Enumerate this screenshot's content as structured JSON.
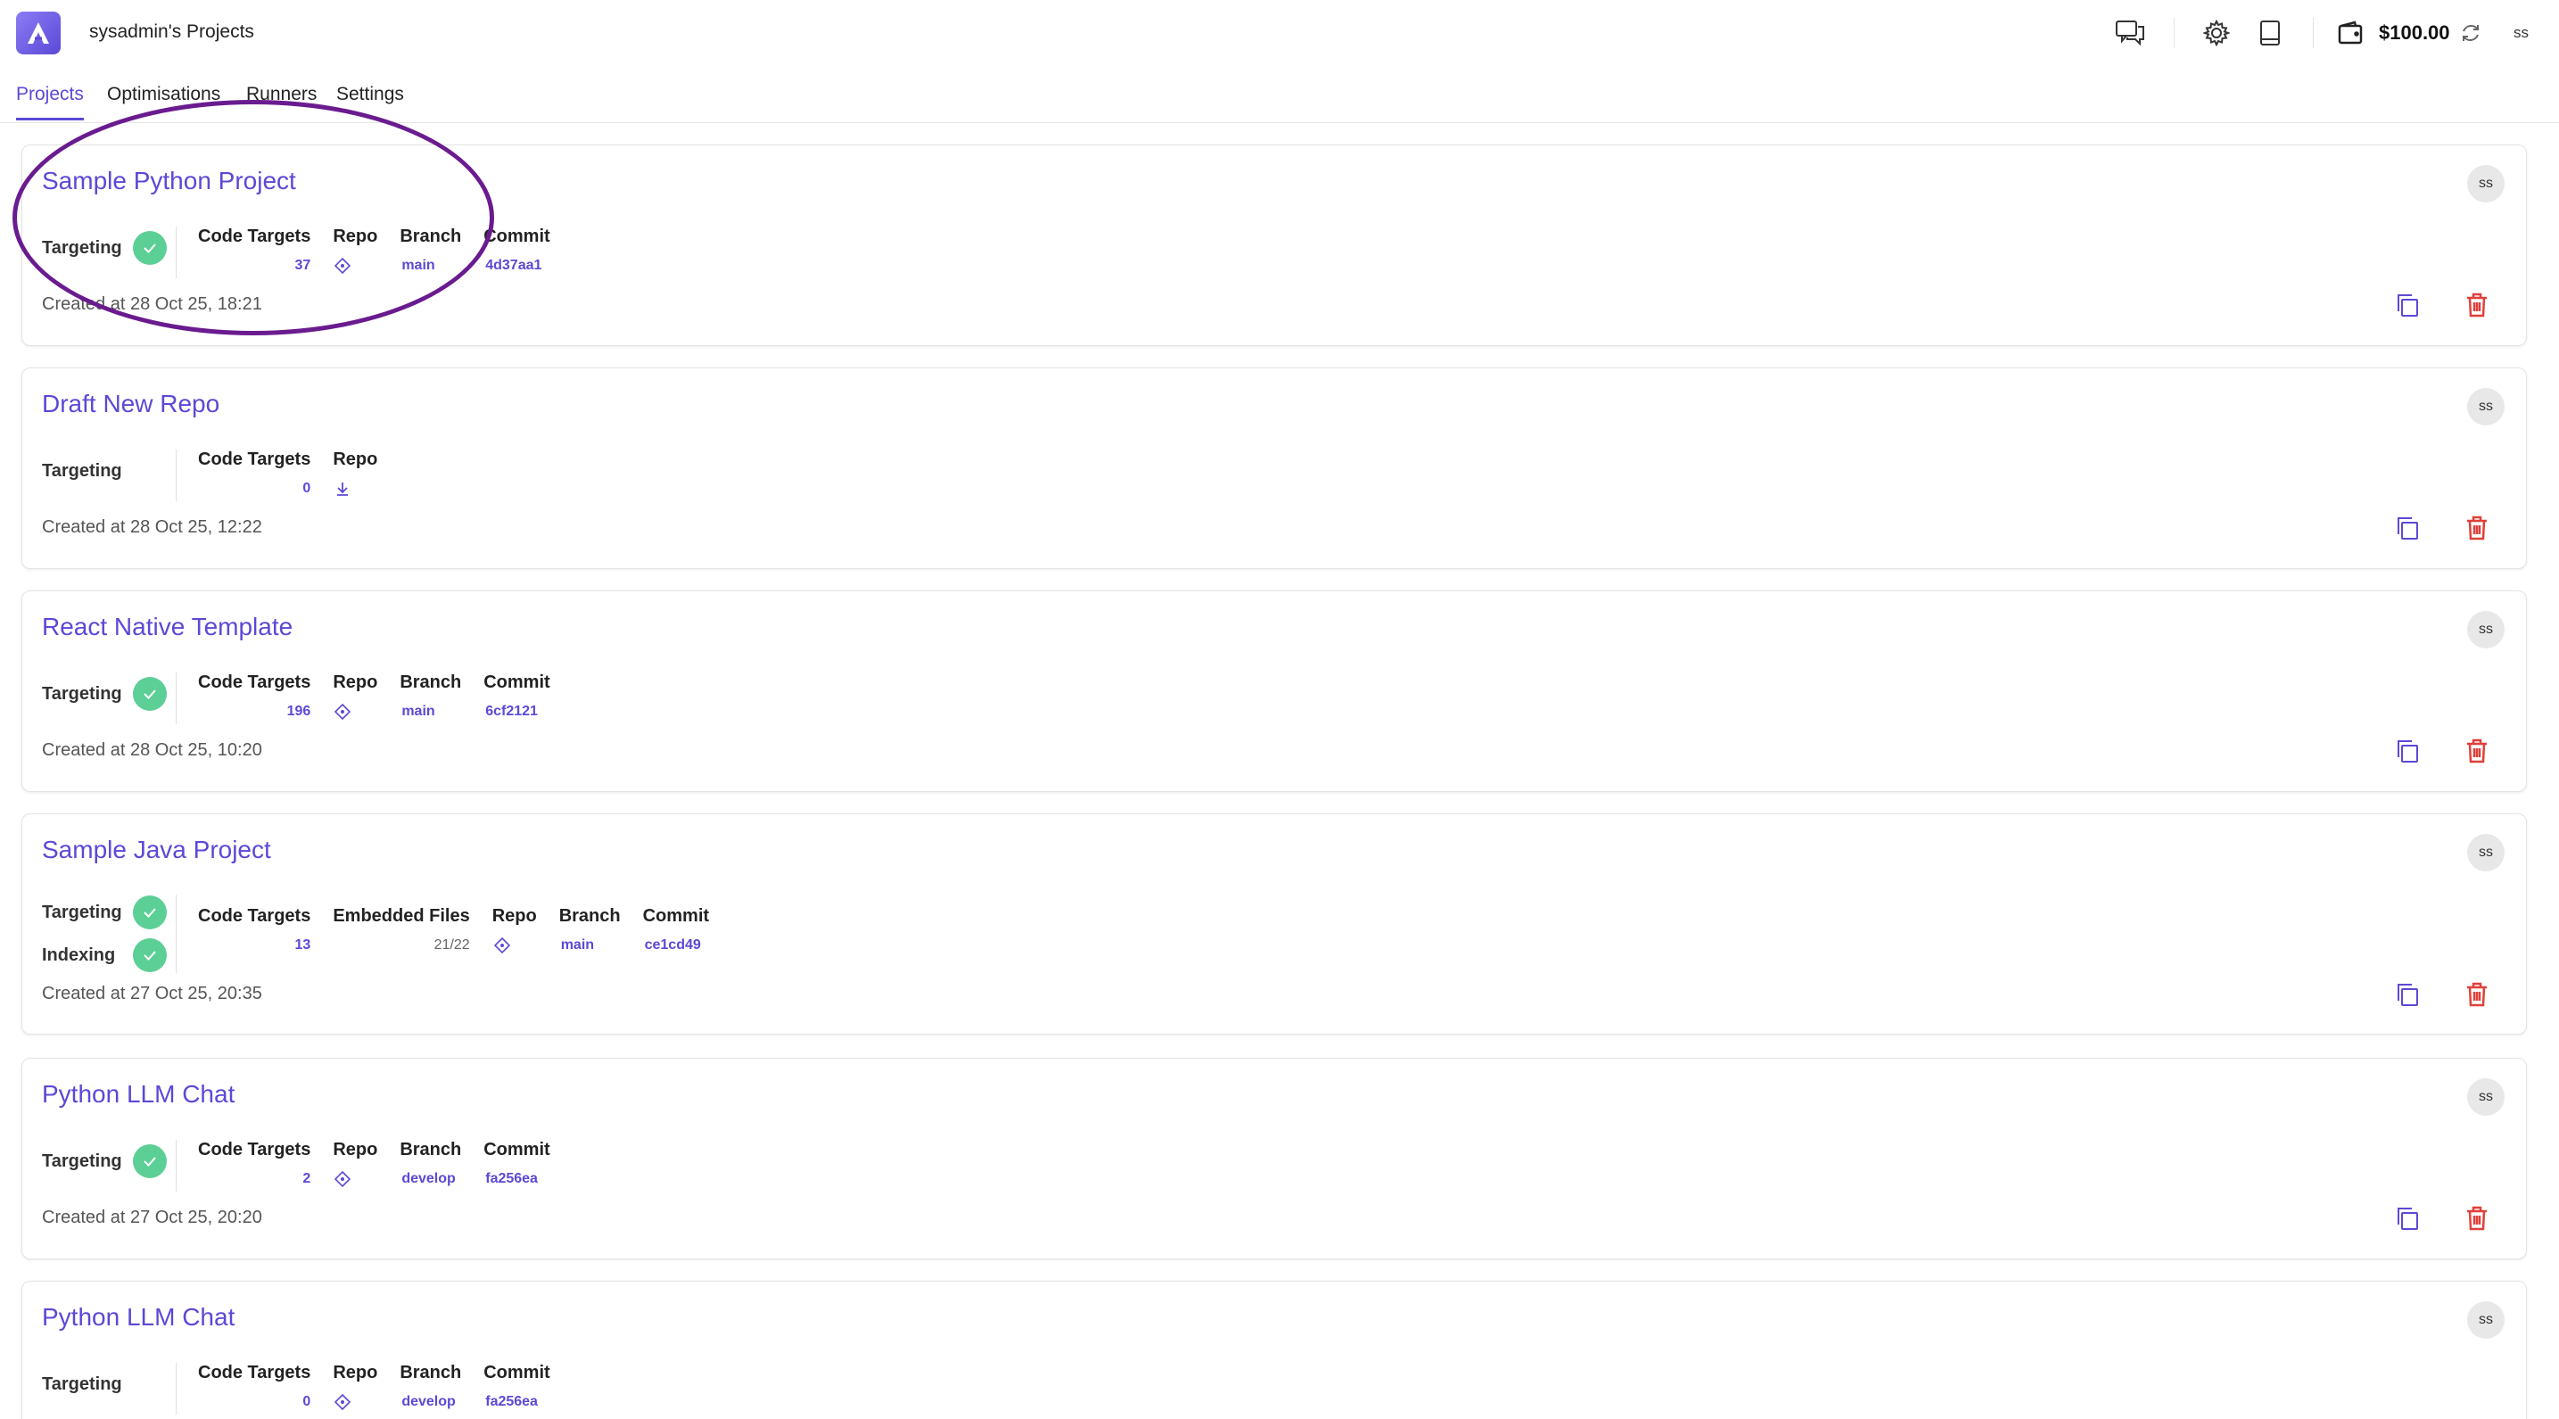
{
  "app": {
    "title": "sysadmin's Projects"
  },
  "header": {
    "balance": "$100.00",
    "user_initials": "ss"
  },
  "tabs": [
    {
      "label": "Projects",
      "active": true
    },
    {
      "label": "Optimisations",
      "active": false
    },
    {
      "label": "Runners",
      "active": false
    },
    {
      "label": "Settings",
      "active": false
    }
  ],
  "colors": {
    "accent": "#5b49d6",
    "success": "#5ccf96",
    "danger": "#e0403a",
    "annotation": "#6a1b8f"
  },
  "labels": {
    "targeting": "Targeting",
    "indexing": "Indexing",
    "code_targets": "Code Targets",
    "embedded_files": "Embedded Files",
    "repo": "Repo",
    "branch": "Branch",
    "commit": "Commit"
  },
  "projects": [
    {
      "name": "Sample Python Project",
      "owner": "ss",
      "targeting_done": true,
      "code_targets": "37",
      "branch": "main",
      "commit": "4d37aa1",
      "created": "Created at 28 Oct 25, 18:21"
    },
    {
      "name": "Draft New Repo",
      "owner": "ss",
      "targeting_done": false,
      "code_targets": "0",
      "created": "Created at 28 Oct 25, 12:22"
    },
    {
      "name": "React Native Template",
      "owner": "ss",
      "targeting_done": true,
      "code_targets": "196",
      "branch": "main",
      "commit": "6cf2121",
      "created": "Created at 28 Oct 25, 10:20"
    },
    {
      "name": "Sample Java Project",
      "owner": "ss",
      "targeting_done": true,
      "indexing_done": true,
      "code_targets": "13",
      "embedded_files": "21/22",
      "branch": "main",
      "commit": "ce1cd49",
      "created": "Created at 27 Oct 25, 20:35"
    },
    {
      "name": "Python LLM Chat",
      "owner": "ss",
      "targeting_done": true,
      "code_targets": "2",
      "branch": "develop",
      "commit": "fa256ea",
      "created": "Created at 27 Oct 25, 20:20"
    },
    {
      "name": "Python LLM Chat",
      "owner": "ss",
      "targeting_done": false,
      "code_targets": "0",
      "branch": "develop",
      "commit": "fa256ea"
    }
  ]
}
